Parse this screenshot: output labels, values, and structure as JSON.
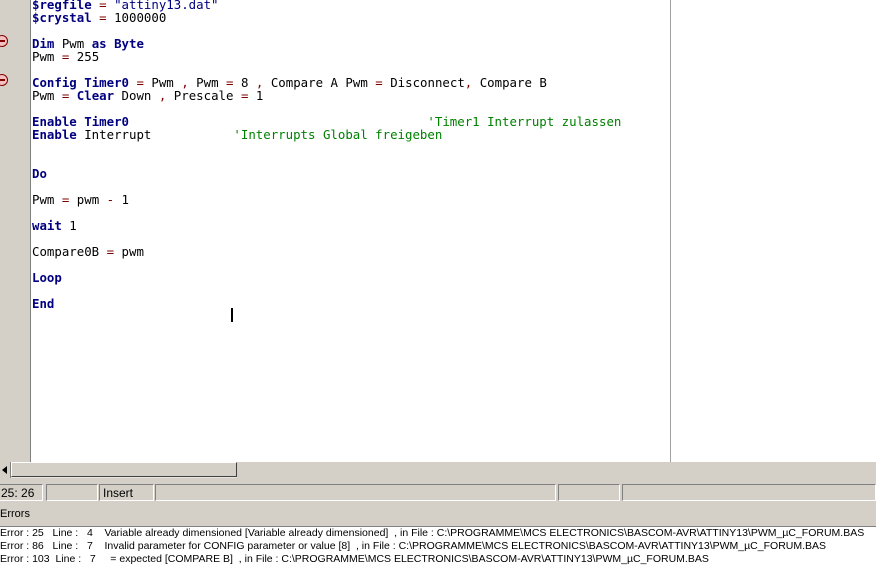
{
  "editor": {
    "lines": [
      [
        [
          "kw",
          "$regfile"
        ],
        [
          "op",
          " = "
        ],
        [
          "str",
          "\"attiny13.dat\""
        ]
      ],
      [
        [
          "kw",
          "$crystal"
        ],
        [
          "op",
          " = "
        ],
        [
          "n",
          "1000000"
        ]
      ],
      [
        [
          "n",
          ""
        ]
      ],
      [
        [
          "kw",
          "Dim"
        ],
        [
          "n",
          " Pwm "
        ],
        [
          "kw",
          "as"
        ],
        [
          "n",
          " "
        ],
        [
          "kw",
          "Byte"
        ]
      ],
      [
        [
          "n",
          "Pwm"
        ],
        [
          "op",
          " = "
        ],
        [
          "n",
          "255"
        ]
      ],
      [
        [
          "n",
          ""
        ]
      ],
      [
        [
          "kw",
          "Config"
        ],
        [
          "n",
          " "
        ],
        [
          "kw",
          "Timer0"
        ],
        [
          "op",
          " = "
        ],
        [
          "n",
          "Pwm"
        ],
        [
          "op",
          " , "
        ],
        [
          "n",
          "Pwm"
        ],
        [
          "op",
          " = "
        ],
        [
          "n",
          "8"
        ],
        [
          "op",
          " , "
        ],
        [
          "n",
          "Compare A Pwm"
        ],
        [
          "op",
          " = "
        ],
        [
          "n",
          "Disconnect"
        ],
        [
          "op",
          ", "
        ],
        [
          "n",
          "Compare B"
        ]
      ],
      [
        [
          "n",
          "Pwm"
        ],
        [
          "op",
          " = "
        ],
        [
          "kw",
          "Clear"
        ],
        [
          "n",
          " Down"
        ],
        [
          "op",
          " , "
        ],
        [
          "n",
          "Prescale"
        ],
        [
          "op",
          " = "
        ],
        [
          "n",
          "1"
        ]
      ],
      [
        [
          "n",
          ""
        ]
      ],
      [
        [
          "kw",
          "Enable"
        ],
        [
          "n",
          " "
        ],
        [
          "kw",
          "Timer0"
        ],
        [
          "n",
          "                                        "
        ],
        [
          "cmt",
          "'Timer1 Interrupt zulassen"
        ]
      ],
      [
        [
          "kw",
          "Enable"
        ],
        [
          "n",
          " Interrupt           "
        ],
        [
          "cmt",
          "'Interrupts Global freigeben"
        ]
      ],
      [
        [
          "n",
          ""
        ]
      ],
      [
        [
          "n",
          ""
        ]
      ],
      [
        [
          "kw",
          "Do"
        ]
      ],
      [
        [
          "n",
          ""
        ]
      ],
      [
        [
          "n",
          "Pwm"
        ],
        [
          "op",
          " = "
        ],
        [
          "n",
          "pwm "
        ],
        [
          "op",
          "-"
        ],
        [
          "n",
          " 1"
        ]
      ],
      [
        [
          "n",
          ""
        ]
      ],
      [
        [
          "kw",
          "wait"
        ],
        [
          "n",
          " 1"
        ]
      ],
      [
        [
          "n",
          ""
        ]
      ],
      [
        [
          "n",
          "Compare0B"
        ],
        [
          "op",
          " = "
        ],
        [
          "n",
          "pwm"
        ]
      ],
      [
        [
          "n",
          ""
        ]
      ],
      [
        [
          "kw",
          "Loop"
        ]
      ],
      [
        [
          "n",
          ""
        ]
      ],
      [
        [
          "kw",
          "End"
        ]
      ]
    ]
  },
  "status": {
    "position": "25: 26",
    "modified": "",
    "mode": "Insert",
    "message": "",
    "panel5": "",
    "panel6": ""
  },
  "errors": {
    "title": "Errors",
    "items": [
      "Error : 25   Line :   4    Variable already dimensioned [Variable already dimensioned]  , in File : C:\\PROGRAMME\\MCS ELECTRONICS\\BASCOM-AVR\\ATTINY13\\PWM_µC_FORUM.BAS",
      "Error : 86   Line :   7    Invalid parameter for CONFIG parameter or value [8]  , in File : C:\\PROGRAMME\\MCS ELECTRONICS\\BASCOM-AVR\\ATTINY13\\PWM_µC_FORUM.BAS",
      "Error : 103  Line :   7     = expected [COMPARE B]  , in File : C:\\PROGRAMME\\MCS ELECTRONICS\\BASCOM-AVR\\ATTINY13\\PWM_µC_FORUM.BAS"
    ]
  }
}
